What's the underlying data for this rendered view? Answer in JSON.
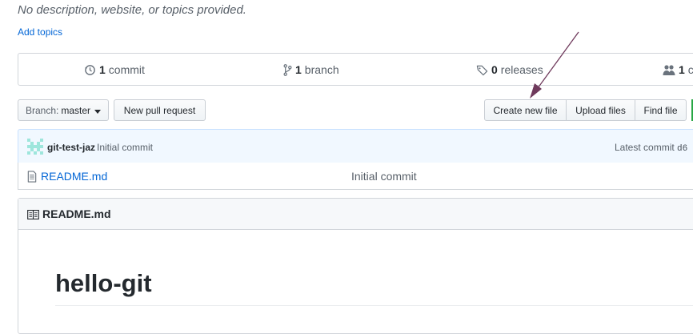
{
  "repo": {
    "description": "No description, website, or topics provided.",
    "add_topics": "Add topics"
  },
  "summary": {
    "commits_count": "1",
    "commits_label": "commit",
    "branches_count": "1",
    "branches_label": "branch",
    "releases_count": "0",
    "releases_label": "releases",
    "contributors_count": "1",
    "contributors_label": "c"
  },
  "toolbar": {
    "branch_prefix": "Branch:",
    "branch_name": "master",
    "new_pull_request": "New pull request",
    "create_new_file": "Create new file",
    "upload_files": "Upload files",
    "find_file": "Find file"
  },
  "latest_commit": {
    "author": "git-test-jaz",
    "message": "Initial commit",
    "label": "Latest commit",
    "sha": "d6"
  },
  "files": [
    {
      "name": "README.md",
      "commit_message": "Initial commit"
    }
  ],
  "readme": {
    "header": "README.md",
    "heading": "hello-git"
  },
  "colors": {
    "link": "#0366d6",
    "commit_bar_bg": "#f1f8ff",
    "annotation_arrow": "#6f3a5c"
  },
  "icons": {
    "commits": "history-icon",
    "branch": "git-branch-icon",
    "releases": "tag-icon",
    "contributors": "people-icon",
    "file": "file-icon",
    "readme": "book-icon",
    "dropdown": "caret-down-icon"
  }
}
